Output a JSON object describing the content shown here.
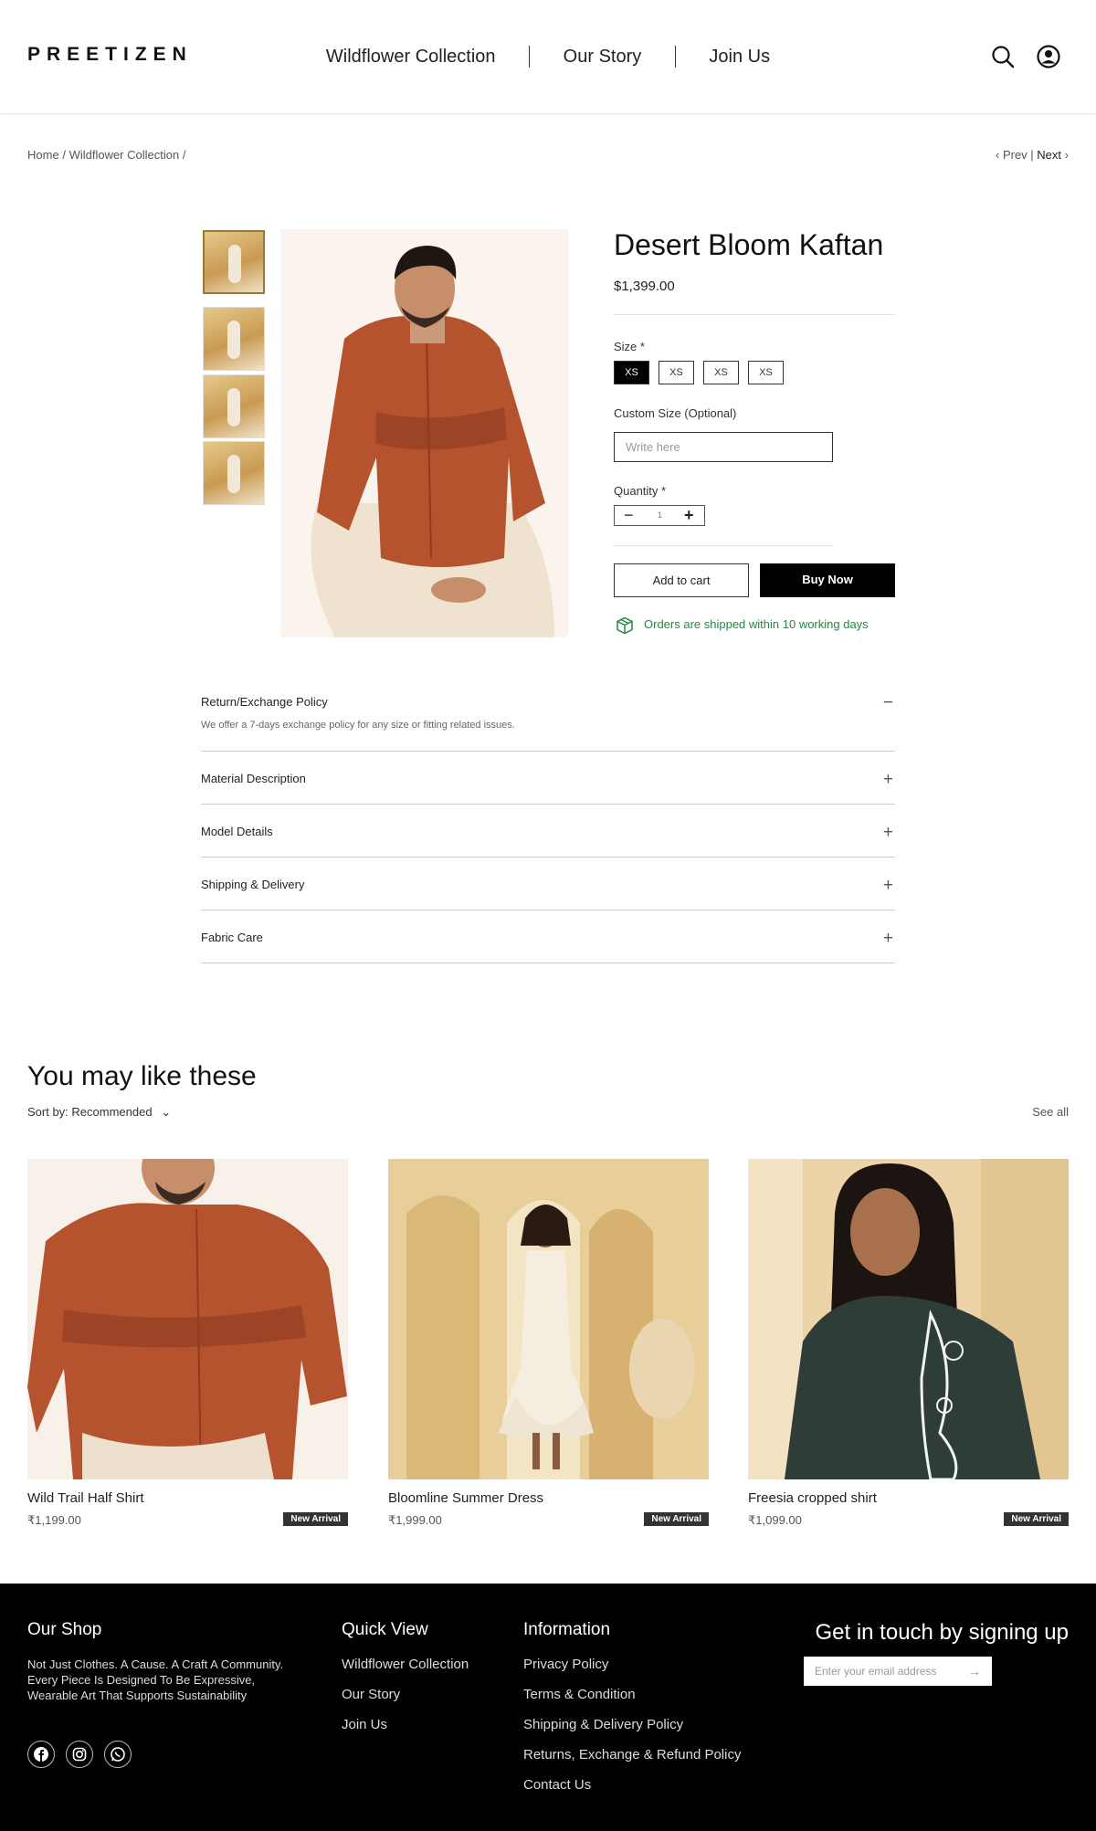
{
  "header": {
    "logo": "PREETIZEN",
    "nav": [
      "Wildflower Collection",
      "Our Story",
      "Join Us"
    ]
  },
  "breadcrumb": {
    "home": "Home",
    "collection": "Wildflower Collection",
    "sep": "/"
  },
  "pager": {
    "prev": "Prev",
    "next": "Next"
  },
  "product": {
    "title": "Desert Bloom Kaftan",
    "price": "$1,399.00",
    "size_label": "Size *",
    "sizes": [
      "XS",
      "XS",
      "XS",
      "XS"
    ],
    "selected_size_index": 0,
    "custom_size_label": "Custom Size (Optional)",
    "custom_size_placeholder": "Write here",
    "quantity_label": "Quantity *",
    "quantity": "1",
    "add_to_cart": "Add to cart",
    "buy_now": "Buy Now",
    "shipping_note": "Orders are shipped within 10 working days"
  },
  "accordion": [
    {
      "title": "Return/Exchange Policy",
      "expanded": true,
      "body": "We offer a 7-days exchange policy for any size or fitting related issues.",
      "icon": "−"
    },
    {
      "title": "Material Description",
      "expanded": false,
      "icon": "+"
    },
    {
      "title": "Model Details",
      "expanded": false,
      "icon": "+"
    },
    {
      "title": "Shipping & Delivery",
      "expanded": false,
      "icon": "+"
    },
    {
      "title": "Fabric Care",
      "expanded": false,
      "icon": "+"
    }
  ],
  "recommend": {
    "title": "You may like these",
    "sort": "Sort by: Recommended",
    "see_all": "See all",
    "items": [
      {
        "name": "Wild Trail Half Shirt",
        "price": "₹1,199.00",
        "badge": "New Arrival"
      },
      {
        "name": "Bloomline Summer Dress",
        "price": "₹1,999.00",
        "badge": "New Arrival"
      },
      {
        "name": "Freesia cropped shirt",
        "price": "₹1,099.00",
        "badge": "New Arrival"
      }
    ]
  },
  "footer": {
    "shop_title": "Our Shop",
    "shop_desc": "Not Just Clothes. A Cause. A Craft A Community. Every Piece Is Designed To Be Expressive, Wearable Art That Supports Sustainability",
    "quick_title": "Quick View",
    "quick_links": [
      "Wildflower Collection",
      "Our Story",
      "Join Us"
    ],
    "info_title": "Information",
    "info_links": [
      "Privacy Policy",
      "Terms & Condition",
      "Shipping & Delivery Policy",
      "Returns, Exchange & Refund Policy",
      "Contact Us"
    ],
    "signup_title": "Get in touch by signing up",
    "email_placeholder": "Enter your email address",
    "social_icons": [
      "facebook-icon",
      "instagram-icon",
      "whatsapp-icon"
    ]
  },
  "colors": {
    "accent": "#000000",
    "ship_green": "#1e8c3a",
    "footer_bg": "#000000",
    "shirt": "#b4532e"
  }
}
